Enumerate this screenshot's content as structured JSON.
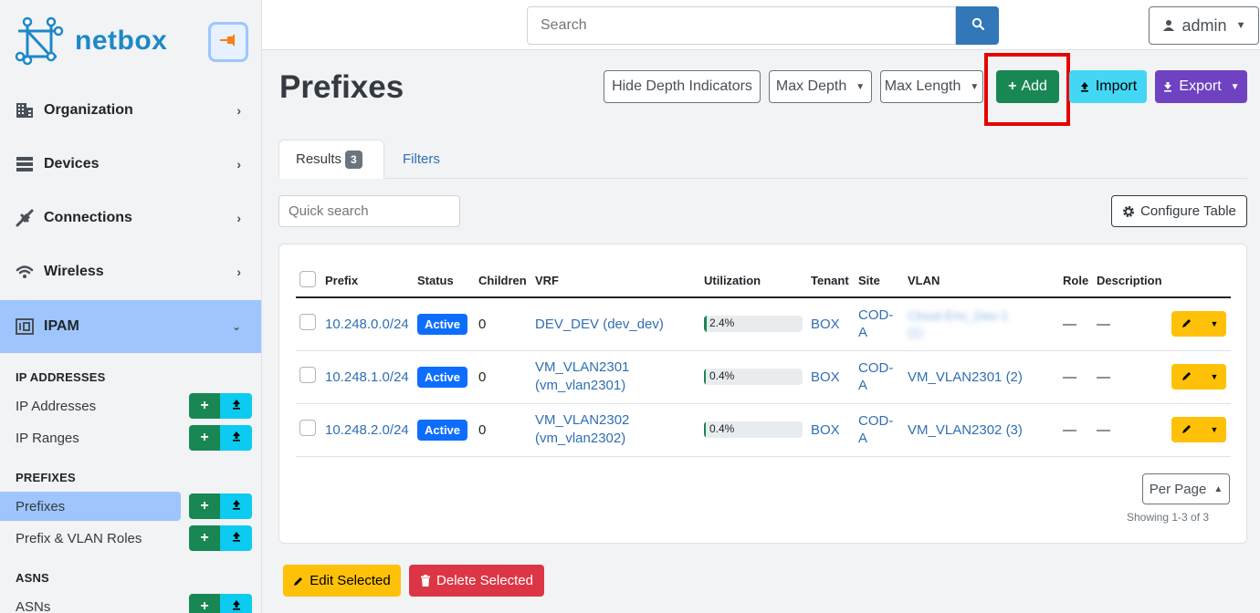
{
  "app": {
    "brand": "netbox"
  },
  "sidebar": {
    "nav": [
      {
        "label": "Organization",
        "icon": "building-icon"
      },
      {
        "label": "Devices",
        "icon": "server-icon"
      },
      {
        "label": "Connections",
        "icon": "plug-icon"
      },
      {
        "label": "Wireless",
        "icon": "wifi-icon"
      },
      {
        "label": "IPAM",
        "icon": "ipam-icon",
        "expanded": true
      }
    ],
    "sections": {
      "ip_addresses": {
        "title": "IP ADDRESSES",
        "items": [
          "IP Addresses",
          "IP Ranges"
        ]
      },
      "prefixes": {
        "title": "PREFIXES",
        "items": [
          "Prefixes",
          "Prefix & VLAN Roles"
        ],
        "active": "Prefixes"
      },
      "asns": {
        "title": "ASNS",
        "items": [
          "ASNs"
        ]
      }
    },
    "mini_add": "+",
    "mini_import": "⇪"
  },
  "topbar": {
    "search_placeholder": "Search",
    "user_label": "admin"
  },
  "header": {
    "title": "Prefixes",
    "buttons": {
      "hide_depth": "Hide Depth Indicators",
      "max_depth": "Max Depth",
      "max_length": "Max Length",
      "add": "Add",
      "import": "Import",
      "export": "Export"
    }
  },
  "tabs": {
    "results": "Results",
    "results_count": "3",
    "filters": "Filters"
  },
  "toolbar": {
    "quick_search_placeholder": "Quick search",
    "configure_table": "Configure Table"
  },
  "table": {
    "columns": [
      "Prefix",
      "Status",
      "Children",
      "VRF",
      "Utilization",
      "Tenant",
      "Site",
      "VLAN",
      "Role",
      "Description"
    ],
    "rows": [
      {
        "prefix": "10.248.0.0/24",
        "status": "Active",
        "children": "0",
        "vrf": "DEV_DEV (dev_dev)",
        "utilization": "2.4%",
        "utilization_fraction": 0.024,
        "tenant": "BOX",
        "site": "COD-A",
        "vlan": "Cloud-Env_Dev-1 (1)",
        "vlan_blurred": true,
        "role": "—",
        "description": "—"
      },
      {
        "prefix": "10.248.1.0/24",
        "status": "Active",
        "children": "0",
        "vrf": "VM_VLAN2301 (vm_vlan2301)",
        "utilization": "0.4%",
        "utilization_fraction": 0.004,
        "tenant": "BOX",
        "site": "COD-A",
        "vlan": "VM_VLAN2301 (2)",
        "vlan_blurred": false,
        "role": "—",
        "description": "—"
      },
      {
        "prefix": "10.248.2.0/24",
        "status": "Active",
        "children": "0",
        "vrf": "VM_VLAN2302 (vm_vlan2302)",
        "utilization": "0.4%",
        "utilization_fraction": 0.004,
        "tenant": "BOX",
        "site": "COD-A",
        "vlan": "VM_VLAN2302 (3)",
        "vlan_blurred": false,
        "role": "—",
        "description": "—"
      }
    ]
  },
  "pagination": {
    "per_page": "Per Page",
    "showing": "Showing 1-3 of 3"
  },
  "bulk": {
    "edit": "Edit Selected",
    "delete": "Delete Selected"
  },
  "colors": {
    "accent": "#9ec5fe",
    "primary": "#0d6efd",
    "success": "#198754",
    "highlight": "#e80000"
  }
}
